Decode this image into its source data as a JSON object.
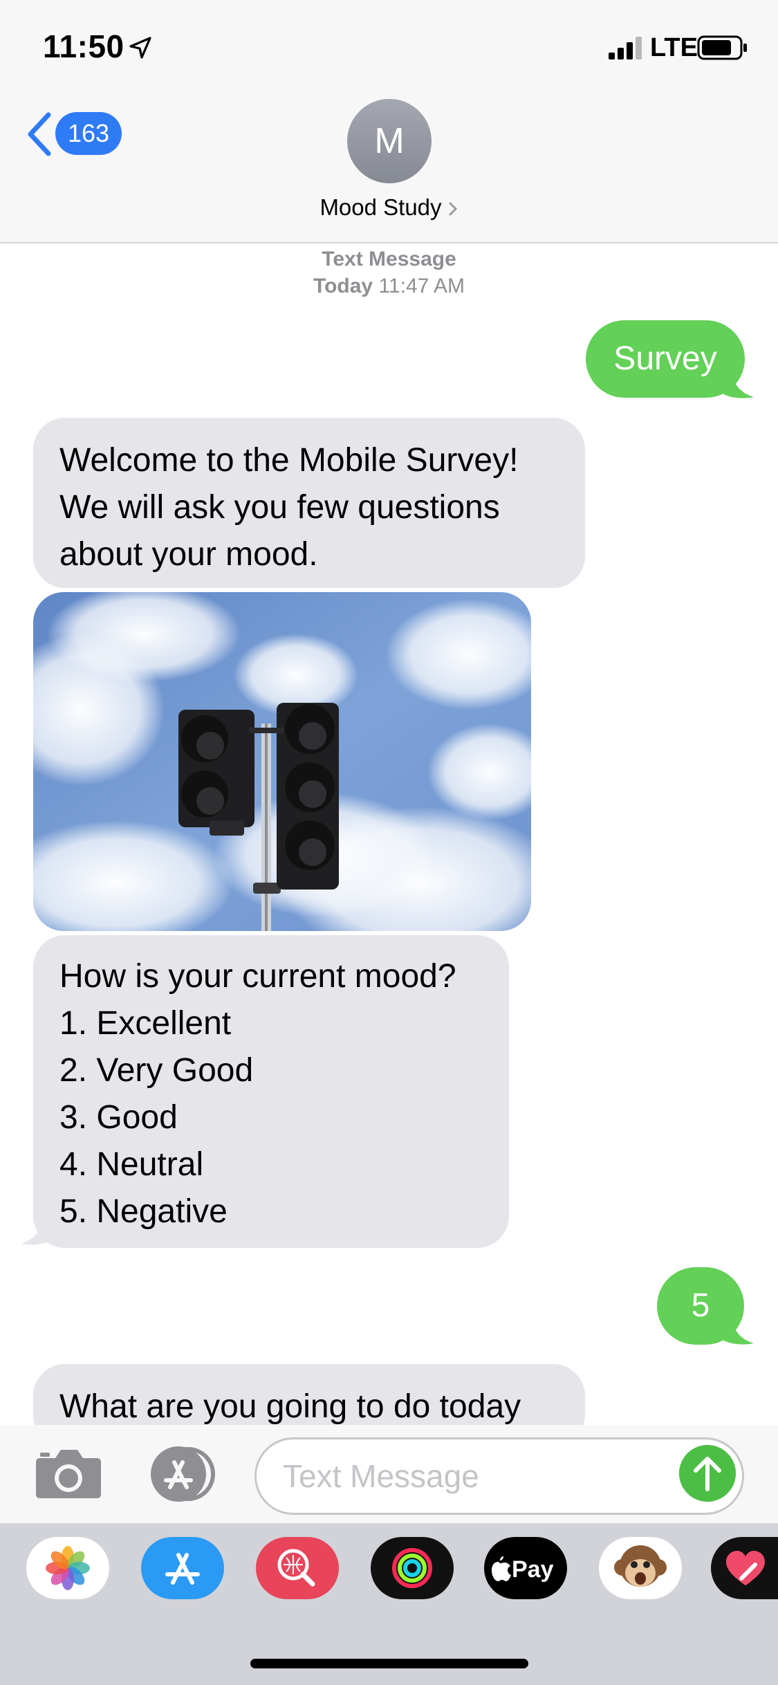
{
  "status_bar": {
    "time": "11:50",
    "carrier": "LTE"
  },
  "nav": {
    "back_count": "163",
    "avatar_initial": "M",
    "contact_name": "Mood Study"
  },
  "conversation": {
    "service_label": "Text Message",
    "date_day": "Today",
    "date_time": "11:47 AM",
    "messages": [
      {
        "direction": "sent",
        "text": "Survey"
      },
      {
        "direction": "received",
        "lines": [
          "Welcome to the Mobile Survey!",
          "We will ask you few questions",
          "about your mood."
        ]
      },
      {
        "direction": "received",
        "type": "photo",
        "subject": "traffic-light-against-cloudy-sky"
      },
      {
        "direction": "received",
        "lines": [
          "How is your current mood?",
          "1. Excellent",
          "2. Very Good",
          "3. Good",
          "4. Neutral",
          "5. Negative"
        ]
      },
      {
        "direction": "sent",
        "text": "5"
      },
      {
        "direction": "received",
        "lines": [
          "What are you going to do today"
        ]
      }
    ]
  },
  "composer": {
    "placeholder": "Text Message"
  },
  "app_drawer": {
    "apps": [
      {
        "name": "Photos",
        "icon": "photos-icon"
      },
      {
        "name": "App Store",
        "icon": "app-store-icon"
      },
      {
        "name": "Search Images",
        "icon": "image-search-icon"
      },
      {
        "name": "Activity",
        "icon": "activity-icon"
      },
      {
        "name": "Apple Pay",
        "icon": "apple-pay-icon",
        "label": "Pay"
      },
      {
        "name": "Animoji",
        "icon": "monkey-animoji-icon"
      },
      {
        "name": "Digital Touch",
        "icon": "heart-touch-icon"
      }
    ]
  },
  "colors": {
    "sent_bubble": "#63d058",
    "received_bubble": "#e5e5ea",
    "accent_blue": "#2f7bf6",
    "send_button": "#4dbe45"
  }
}
